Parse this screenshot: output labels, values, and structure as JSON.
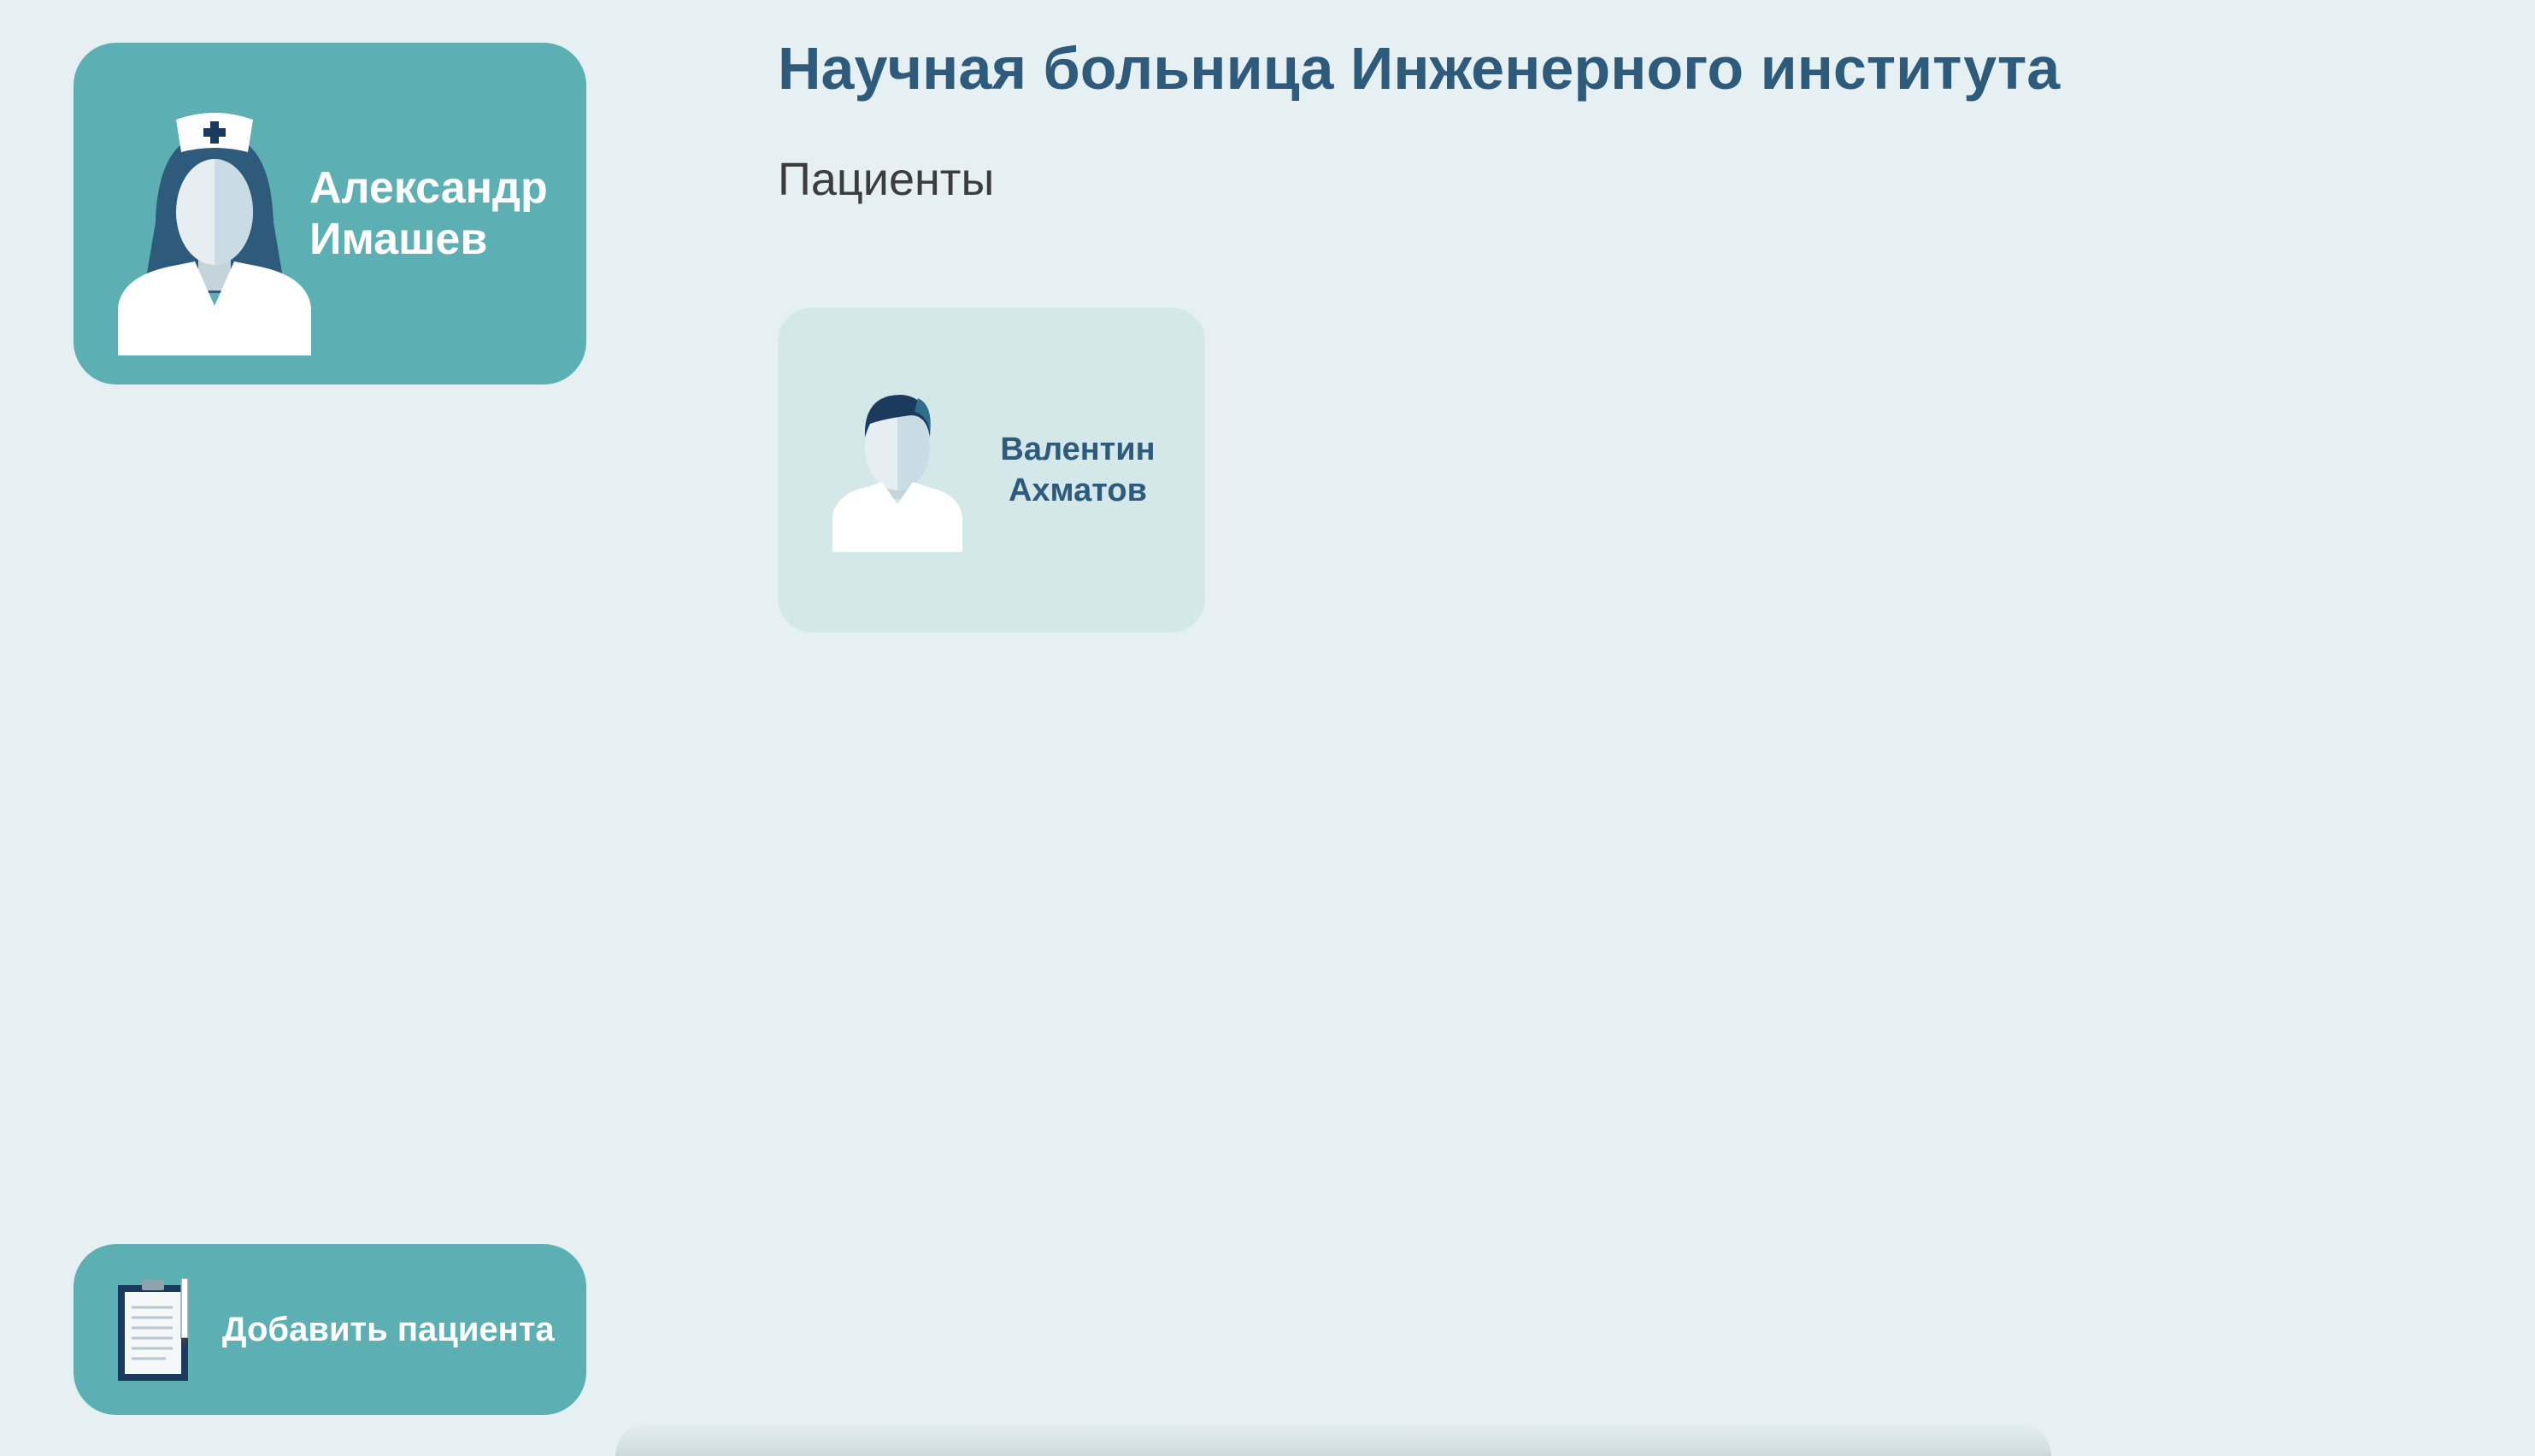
{
  "user": {
    "name": "Александр Имашев",
    "avatar_icon": "nurse-icon"
  },
  "header": {
    "hospital_title": "Научная больница Инженерного института",
    "section_title": "Пациенты"
  },
  "patients": [
    {
      "name": "Валентин Ахматов",
      "avatar_icon": "male-patient-icon"
    }
  ],
  "actions": {
    "add_patient_label": "Добавить пациента",
    "add_patient_icon": "clipboard-icon"
  },
  "colors": {
    "background": "#e6f0f2",
    "card_teal": "#5cb0b3",
    "patient_card": "#d4e7e9",
    "title_blue": "#2e5a7c",
    "navy": "#1c3a5e"
  }
}
